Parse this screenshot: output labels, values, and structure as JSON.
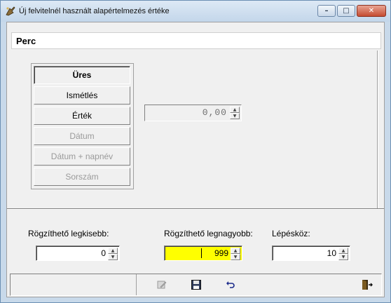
{
  "window": {
    "title": "Új felvitelnél használt alapértelmezés értéke",
    "controls": [
      "minimize",
      "maximize",
      "close"
    ]
  },
  "header": {
    "title": "Perc"
  },
  "options": [
    {
      "label": "Üres",
      "state": "selected"
    },
    {
      "label": "Ismétlés",
      "state": "enabled"
    },
    {
      "label": "Érték",
      "state": "enabled"
    },
    {
      "label": "Dátum",
      "state": "disabled"
    },
    {
      "label": "Dátum + napnév",
      "state": "disabled"
    },
    {
      "label": "Sorszám",
      "state": "disabled"
    }
  ],
  "value_spinner": {
    "value": "0,00"
  },
  "fields": {
    "min": {
      "label": "Rögzíthető legkisebb:",
      "value": "0"
    },
    "max": {
      "label": "Rögzíthető legnagyobb:",
      "value": "999"
    },
    "step": {
      "label": "Lépésköz:",
      "value": "10"
    }
  },
  "toolbar": {
    "icons": [
      "edit-icon",
      "save-icon",
      "undo-icon",
      "exit-icon"
    ]
  },
  "colors": {
    "highlight_field": "#ffff00",
    "titlebar": "#c8d9ea",
    "close_button": "#c54b31"
  }
}
